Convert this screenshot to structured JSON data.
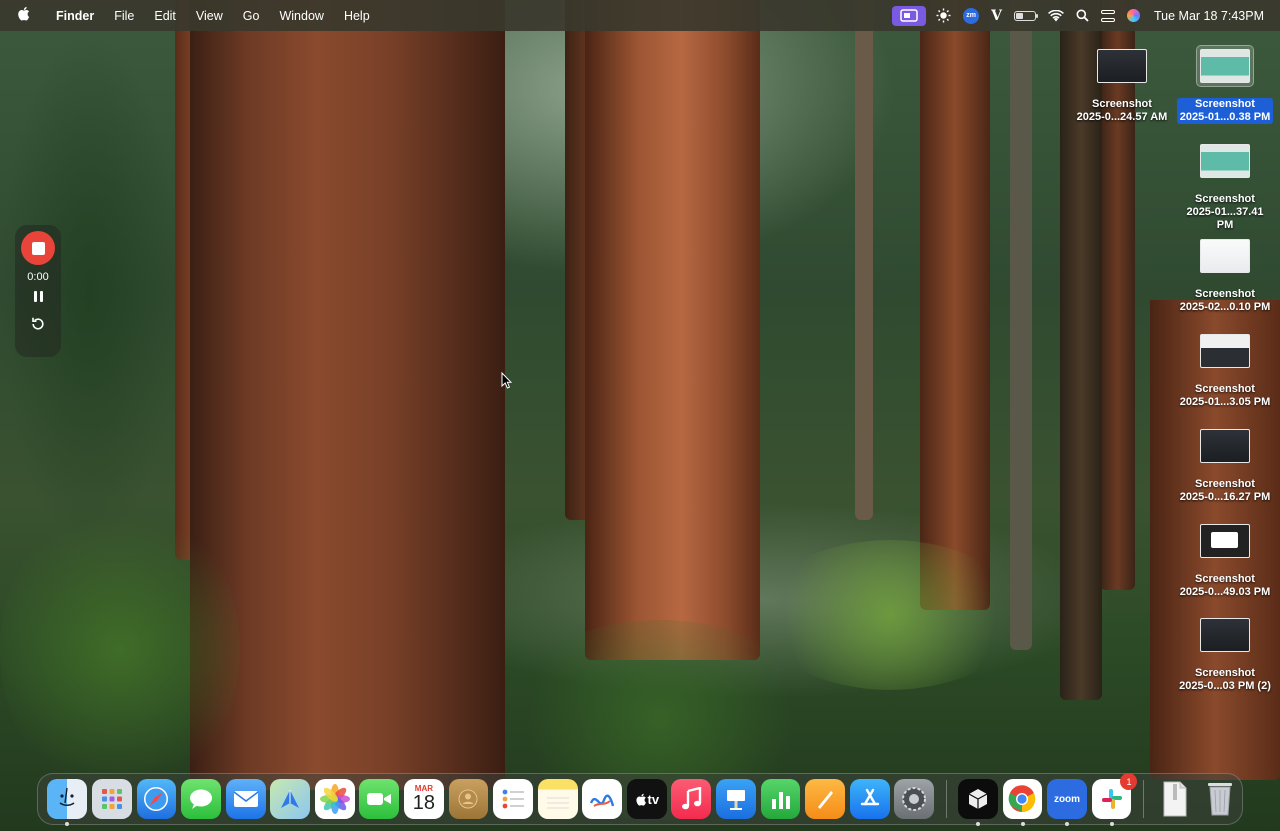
{
  "menubar": {
    "app_name": "Finder",
    "items": [
      "File",
      "Edit",
      "View",
      "Go",
      "Window",
      "Help"
    ],
    "clock": "Tue Mar 18  7:43PM",
    "zoom_badge": "zm",
    "v_logo": "V"
  },
  "recorder": {
    "time": "0:00"
  },
  "desktop_icons": [
    {
      "line1": "Screenshot",
      "line2": "2025-0...24.57 AM",
      "thumb": "dark",
      "selected": false
    },
    {
      "line1": "Screenshot",
      "line2": "2025-01...0.38 PM",
      "thumb": "teal",
      "selected": true
    },
    {
      "line1": "Screenshot",
      "line2": "2025-01...37.41 PM",
      "thumb": "teal",
      "selected": false
    },
    {
      "line1": "Screenshot",
      "line2": "2025-02...0.10 PM",
      "thumb": "light",
      "selected": false
    },
    {
      "line1": "Screenshot",
      "line2": "2025-01...3.05 PM",
      "thumb": "window",
      "selected": false
    },
    {
      "line1": "Screenshot",
      "line2": "2025-0...16.27 PM",
      "thumb": "dark",
      "selected": false
    },
    {
      "line1": "Screenshot",
      "line2": "2025-0...49.03 PM",
      "thumb": "whitebox",
      "selected": false
    },
    {
      "line1": "Screenshot",
      "line2": "2025-0...03 PM (2)",
      "thumb": "dark",
      "selected": false
    }
  ],
  "dock": {
    "calendar_month": "MAR",
    "calendar_day": "18",
    "tv_label": "tv",
    "zoom_label": "zoom",
    "slack_badge": "1"
  },
  "colors": {
    "selection": "#1c5fd6",
    "record_red": "#e8443a",
    "menubar_bg": "#3a382c"
  }
}
